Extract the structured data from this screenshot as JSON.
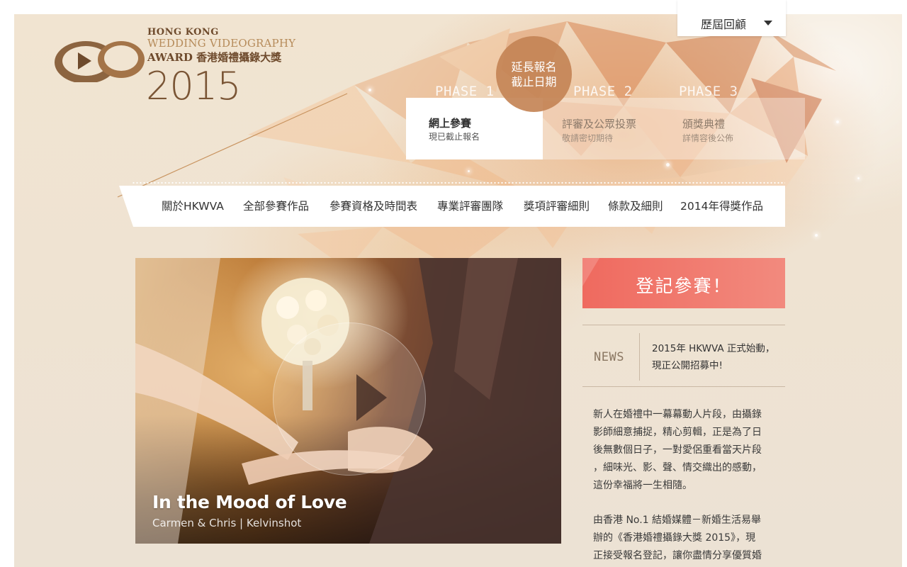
{
  "header": {
    "logo": {
      "line1": "HONG KONG",
      "line2": "WEDDING VIDEOGRAPHY",
      "line3": "AWARD 香港婚禮攝錄大獎",
      "year": "2015"
    },
    "archive_dropdown": {
      "label": "歷屆回顧"
    },
    "deadline_badge": {
      "line1": "延長報名",
      "line2": "截止日期"
    }
  },
  "phases": [
    {
      "tag": "PHASE 1",
      "title": "網上參賽",
      "subtitle": "現已截止報名",
      "active": true
    },
    {
      "tag": "PHASE 2",
      "title": "評審及公眾投票",
      "subtitle": "敬請密切期待",
      "active": false
    },
    {
      "tag": "PHASE 3",
      "title": "頒獎典禮",
      "subtitle": "詳情容後公佈",
      "active": false
    }
  ],
  "nav": [
    "關於HKWVA",
    "全部參賽作品",
    "參賽資格及時間表",
    "專業評審團隊",
    "獎項評審細則",
    "條款及細則",
    "2014年得獎作品"
  ],
  "video": {
    "title": "In the Mood of Love",
    "credit": "Carmen & Chris | Kelvinshot"
  },
  "register": {
    "label": "登記參賽！"
  },
  "news": {
    "label": "NEWS",
    "line1": "2015年 HKWVA 正式始動，",
    "line2": "現正公開招募中!"
  },
  "intro": {
    "p1": [
      "新人在婚禮中一幕幕動人片段，由攝錄",
      "影師細意捕捉，精心剪輯，正是為了日",
      "後無數個日子，一對愛侶重看當天片段",
      "，細味光、影、聲、情交織出的感動，",
      "這份幸福將一生相隨。"
    ],
    "p2": [
      "由香港 No.1 結婚媒體－新婚生活易舉",
      "辦的《香港婚禮攝錄大獎 2015》，現",
      "正接受報名登記，讓你盡情分享優質婚"
    ]
  },
  "colors": {
    "accent_gold": "#b68b5a",
    "brand_brown": "#6e4a2c",
    "deadline_circle": "#c48456",
    "register_button": "#ef6a5f"
  }
}
